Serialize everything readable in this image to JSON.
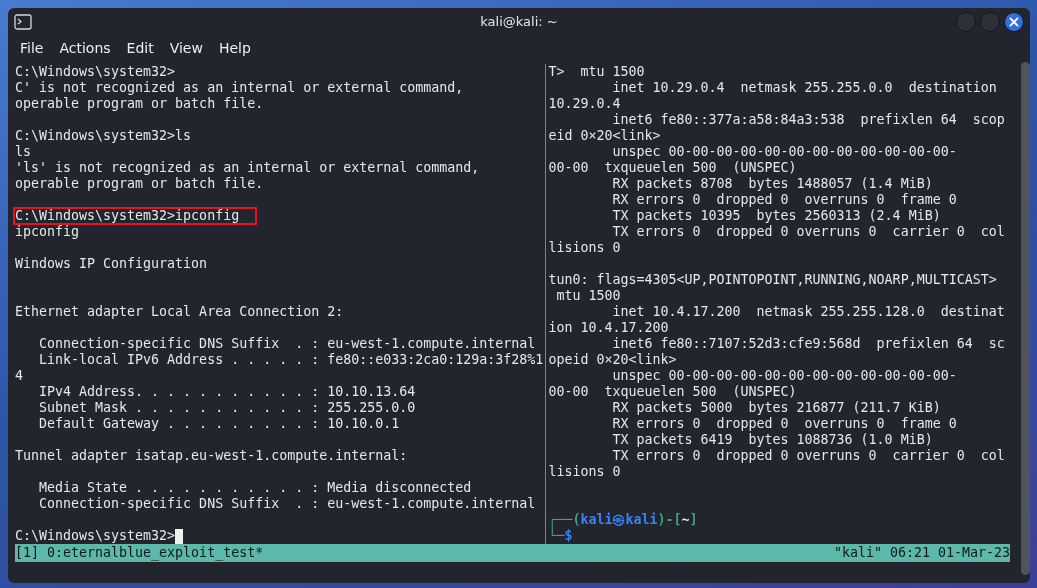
{
  "window": {
    "title": "kali@kali: ~"
  },
  "menu": [
    "File",
    "Actions",
    "Edit",
    "View",
    "Help"
  ],
  "panes": [
    {
      "lines": [
        {
          "kind": "text",
          "text": "C:\\Windows\\system32>"
        },
        {
          "kind": "text",
          "text": "C' is not recognized as an internal or external command,"
        },
        {
          "kind": "text",
          "text": "operable program or batch file."
        },
        {
          "kind": "blank"
        },
        {
          "kind": "text",
          "text": "C:\\Windows\\system32>ls"
        },
        {
          "kind": "text",
          "text": "ls"
        },
        {
          "kind": "text",
          "text": "'ls' is not recognized as an internal or external command,"
        },
        {
          "kind": "text",
          "text": "operable program or batch file."
        },
        {
          "kind": "blank"
        },
        {
          "kind": "boxed",
          "text": "C:\\Windows\\system32>ipconfig"
        },
        {
          "kind": "text",
          "text": "ipconfig"
        },
        {
          "kind": "blank"
        },
        {
          "kind": "text",
          "text": "Windows IP Configuration"
        },
        {
          "kind": "blank"
        },
        {
          "kind": "blank"
        },
        {
          "kind": "text",
          "text": "Ethernet adapter Local Area Connection 2:"
        },
        {
          "kind": "blank"
        },
        {
          "kind": "text",
          "text": "   Connection-specific DNS Suffix  . : eu-west-1.compute.internal"
        },
        {
          "kind": "text",
          "text": "   Link-local IPv6 Address . . . . . : fe80::e033:2ca0:129a:3f28%1"
        },
        {
          "kind": "text",
          "text": "4"
        },
        {
          "kind": "text",
          "text": "   IPv4 Address. . . . . . . . . . . : 10.10.13.64"
        },
        {
          "kind": "text",
          "text": "   Subnet Mask . . . . . . . . . . . : 255.255.0.0"
        },
        {
          "kind": "text",
          "text": "   Default Gateway . . . . . . . . . : 10.10.0.1"
        },
        {
          "kind": "blank"
        },
        {
          "kind": "text",
          "text": "Tunnel adapter isatap.eu-west-1.compute.internal:"
        },
        {
          "kind": "blank"
        },
        {
          "kind": "text",
          "text": "   Media State . . . . . . . . . . . : Media disconnected"
        },
        {
          "kind": "text",
          "text": "   Connection-specific DNS Suffix  . : eu-west-1.compute.internal"
        },
        {
          "kind": "blank"
        },
        {
          "kind": "cursor",
          "text": "C:\\Windows\\system32>"
        }
      ]
    },
    {
      "lines": [
        {
          "kind": "text",
          "text": "T>  mtu 1500"
        },
        {
          "kind": "text",
          "text": "        inet 10.29.0.4  netmask 255.255.0.0  destination"
        },
        {
          "kind": "text",
          "text": "10.29.0.4"
        },
        {
          "kind": "text",
          "text": "        inet6 fe80::377a:a58:84a3:538  prefixlen 64  scop"
        },
        {
          "kind": "text",
          "text": "eid 0×20<link>"
        },
        {
          "kind": "text",
          "text": "        unspec 00-00-00-00-00-00-00-00-00-00-00-00-"
        },
        {
          "kind": "text",
          "text": "00-00  txqueuelen 500  (UNSPEC)"
        },
        {
          "kind": "text",
          "text": "        RX packets 8708  bytes 1488057 (1.4 MiB)"
        },
        {
          "kind": "text",
          "text": "        RX errors 0  dropped 0  overruns 0  frame 0"
        },
        {
          "kind": "text",
          "text": "        TX packets 10395  bytes 2560313 (2.4 MiB)"
        },
        {
          "kind": "text",
          "text": "        TX errors 0  dropped 0 overruns 0  carrier 0  col"
        },
        {
          "kind": "text",
          "text": "lisions 0"
        },
        {
          "kind": "blank"
        },
        {
          "kind": "text",
          "text": "tun0: flags=4305<UP,POINTOPOINT,RUNNING,NOARP,MULTICAST>"
        },
        {
          "kind": "text",
          "text": " mtu 1500"
        },
        {
          "kind": "text",
          "text": "        inet 10.4.17.200  netmask 255.255.128.0  destinat"
        },
        {
          "kind": "text",
          "text": "ion 10.4.17.200"
        },
        {
          "kind": "text",
          "text": "        inet6 fe80::7107:52d3:cfe9:568d  prefixlen 64  sc"
        },
        {
          "kind": "text",
          "text": "opeid 0×20<link>"
        },
        {
          "kind": "text",
          "text": "        unspec 00-00-00-00-00-00-00-00-00-00-00-00-"
        },
        {
          "kind": "text",
          "text": "00-00  txqueuelen 500  (UNSPEC)"
        },
        {
          "kind": "text",
          "text": "        RX packets 5000  bytes 216877 (211.7 KiB)"
        },
        {
          "kind": "text",
          "text": "        RX errors 0  dropped 0  overruns 0  frame 0"
        },
        {
          "kind": "text",
          "text": "        TX packets 6419  bytes 1088736 (1.0 MiB)"
        },
        {
          "kind": "text",
          "text": "        TX errors 0  dropped 0 overruns 0  carrier 0  col"
        },
        {
          "kind": "text",
          "text": "lisions 0"
        },
        {
          "kind": "blank"
        },
        {
          "kind": "blank"
        },
        {
          "kind": "prompt",
          "parts": [
            {
              "text": "┌──(",
              "color": "#3fa37e"
            },
            {
              "text": "kali㉿kali",
              "color": "#3b82f6"
            },
            {
              "text": ")-[",
              "color": "#3fa37e"
            },
            {
              "text": "~",
              "color": "#e6e6e6"
            },
            {
              "text": "]",
              "color": "#3fa37e"
            }
          ]
        },
        {
          "kind": "prompt",
          "parts": [
            {
              "text": "└─",
              "color": "#3fa37e"
            },
            {
              "text": "$",
              "color": "#3b82f6"
            }
          ]
        }
      ]
    }
  ],
  "status_bar": {
    "left": "[1] 0:eternalblue_exploit_test*",
    "right": "\"kali\" 06:21 01-Mar-23"
  }
}
